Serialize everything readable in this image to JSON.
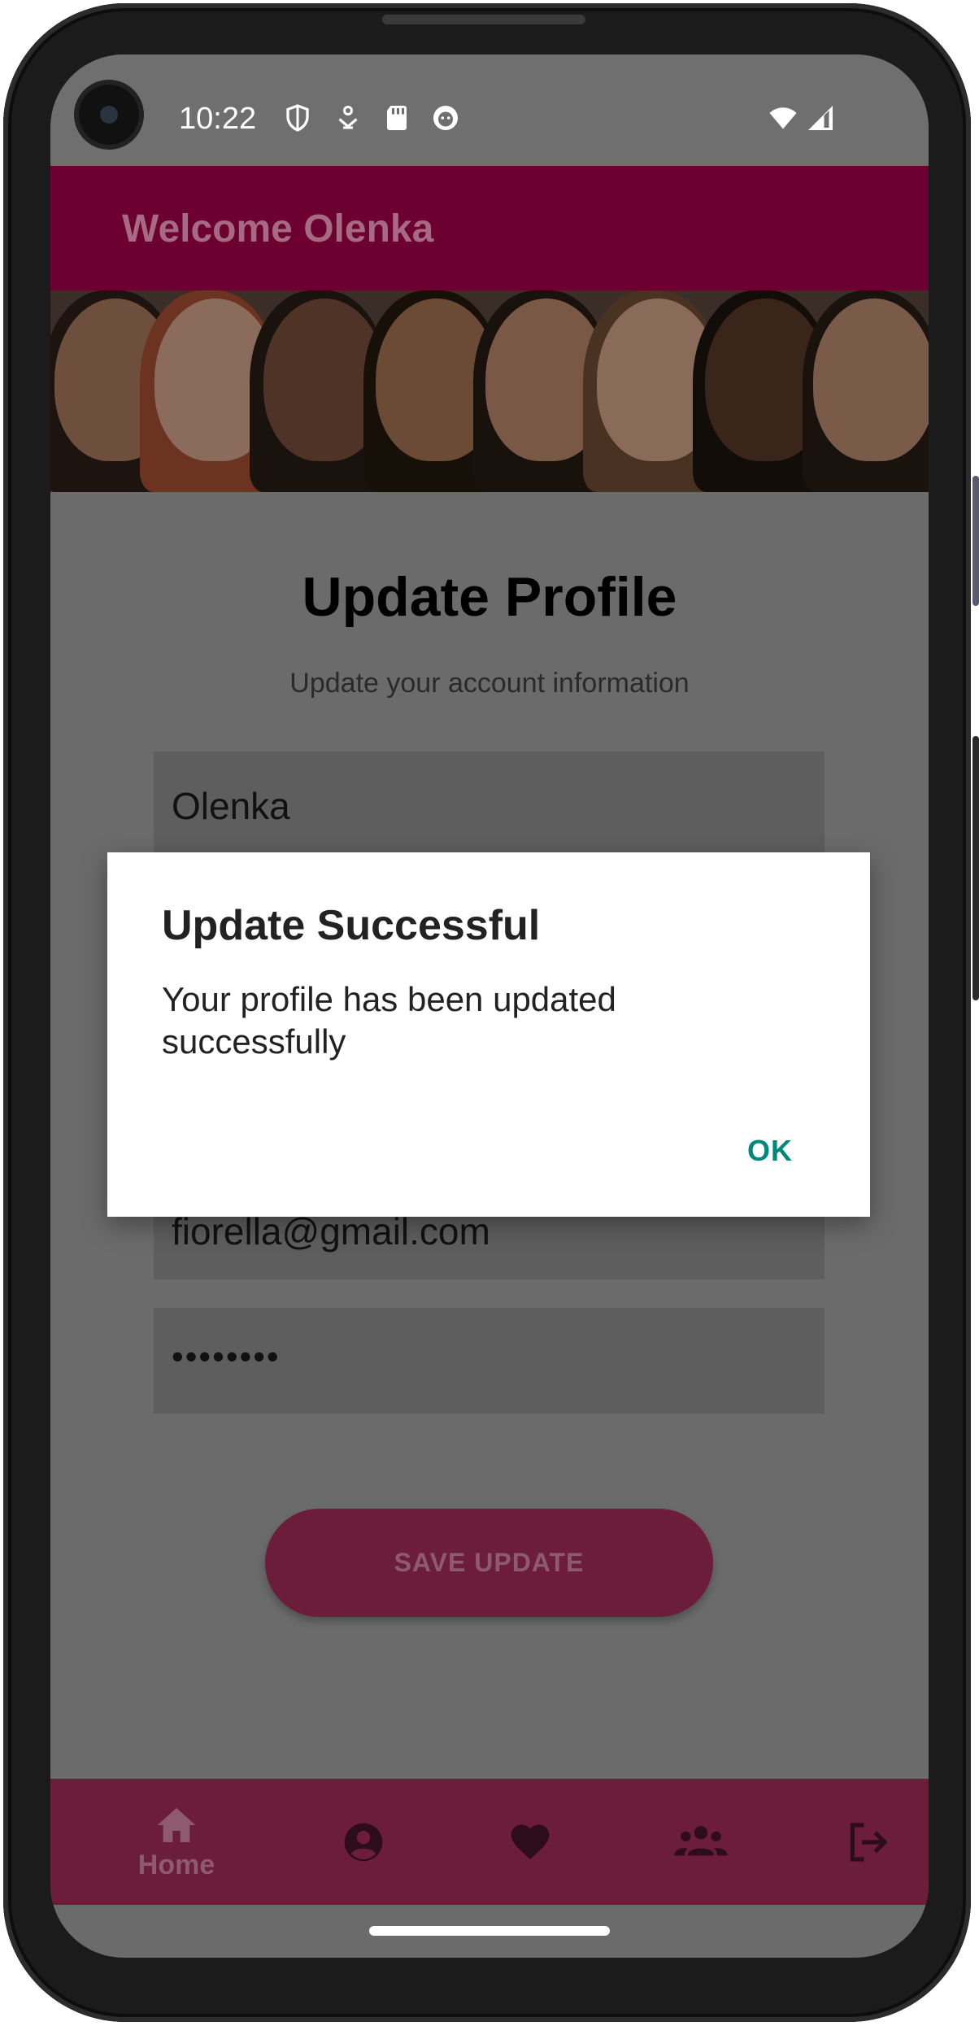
{
  "status_bar": {
    "time": "10:22",
    "icons": [
      "shield-icon",
      "location-icon",
      "sd-card-icon",
      "face-icon",
      "wifi-icon",
      "cell-signal-icon"
    ]
  },
  "app_bar": {
    "title": "Welcome Olenka"
  },
  "banner": {
    "icon": "group-portrait-photo"
  },
  "form": {
    "title": "Update Profile",
    "subtitle": "Update your account information",
    "name_value": "Olenka",
    "email_value": "fiorella@gmail.com",
    "password_value": "••••••••",
    "save_label": "SAVE UPDATE"
  },
  "dialog": {
    "title": "Update Successful",
    "message": "Your profile has been updated successfully",
    "ok_label": "OK"
  },
  "bottom_nav": {
    "items": [
      {
        "icon": "home-icon",
        "label": "Home"
      },
      {
        "icon": "profile-icon",
        "label": ""
      },
      {
        "icon": "heart-icon",
        "label": ""
      },
      {
        "icon": "group-icon",
        "label": ""
      },
      {
        "icon": "logout-icon",
        "label": ""
      }
    ]
  },
  "colors": {
    "app_bar": "#6c0030",
    "nav_bar": "#6c1d39",
    "dialog_action": "#00897b"
  }
}
